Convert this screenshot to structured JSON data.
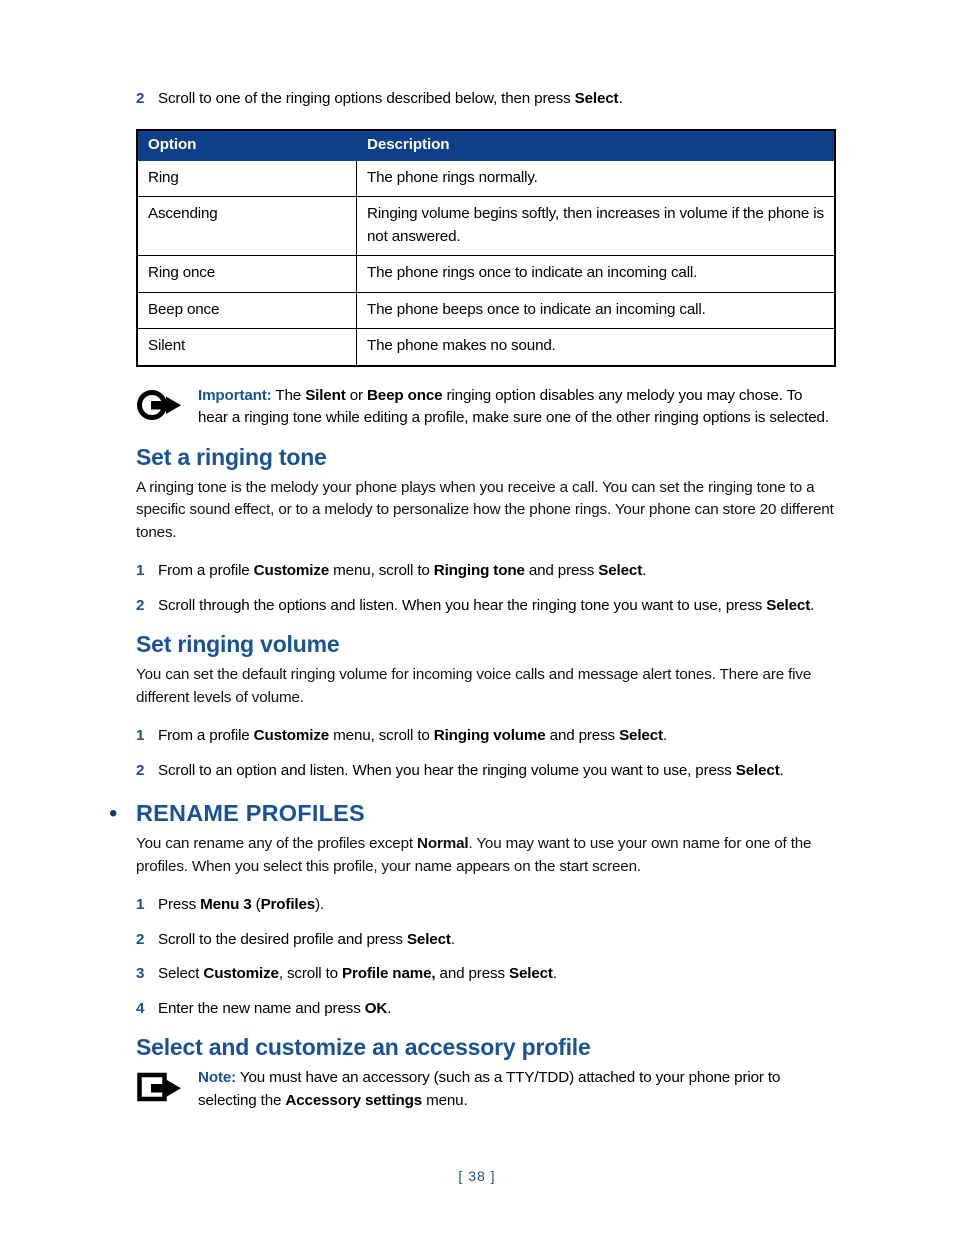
{
  "page": {
    "number_label": "[ 38 ]"
  },
  "intro_step": {
    "num": "2",
    "text_before": "Scroll to one of the ringing options described below, then press ",
    "bold": "Select",
    "text_after": "."
  },
  "table": {
    "headers": [
      "Option",
      "Description"
    ],
    "rows": [
      {
        "option": "Ring",
        "description": "The phone rings normally."
      },
      {
        "option": "Ascending",
        "description": "Ringing volume begins softly, then increases in volume if the phone is not answered."
      },
      {
        "option": "Ring once",
        "description": "The phone rings once to indicate an incoming call."
      },
      {
        "option": "Beep once",
        "description": "The phone beeps once to indicate an incoming call."
      },
      {
        "option": "Silent",
        "description": "The phone makes no sound."
      }
    ]
  },
  "important_note": {
    "icon": "circle-arrow-right-icon",
    "label": "Important:",
    "p1": " The ",
    "b1": "Silent",
    "p2": " or ",
    "b2": "Beep once",
    "p3": " ringing option disables any melody you may chose. To hear a ringing tone while editing a profile, make sure one of the other ringing options is selected."
  },
  "set_ringing_tone": {
    "heading": "Set a ringing tone",
    "paragraph": "A ringing tone is the melody your phone plays when you receive a call. You can set the ringing tone to a specific sound effect, or to a melody to personalize how the phone rings. Your phone can store 20 different tones.",
    "steps": [
      {
        "num": "1",
        "t1": "From a profile ",
        "b1": "Customize",
        "t2": " menu, scroll to ",
        "b2": "Ringing tone",
        "t3": " and press ",
        "b3": "Select",
        "t4": "."
      },
      {
        "num": "2",
        "t1": "Scroll through the options and listen. When you hear the ringing tone you want to use, press ",
        "b1": "Select",
        "t2": "."
      }
    ]
  },
  "set_ringing_volume": {
    "heading": "Set ringing volume",
    "paragraph": "You can set the default ringing volume for incoming voice calls and message alert tones. There are five different levels of volume.",
    "steps": [
      {
        "num": "1",
        "t1": "From a profile ",
        "b1": "Customize",
        "t2": " menu, scroll to ",
        "b2": "Ringing volume",
        "t3": " and press ",
        "b3": "Select",
        "t4": "."
      },
      {
        "num": "2",
        "t1": "Scroll to an option and listen. When you hear the ringing volume you want to use, press ",
        "b1": "Select",
        "t2": "."
      }
    ]
  },
  "rename_profiles": {
    "bullet": "•",
    "heading": "RENAME PROFILES",
    "p1": "You can rename any of the profiles except ",
    "b1": "Normal",
    "p2": ". You may want to use your own name for one of the profiles. When you select this profile, your name appears on the start screen.",
    "steps": [
      {
        "num": "1",
        "t1": "Press ",
        "b1": "Menu 3",
        "t2": " (",
        "b2": "Profiles",
        "t3": ")."
      },
      {
        "num": "2",
        "t1": "Scroll to the desired profile and press ",
        "b1": "Select",
        "t2": "."
      },
      {
        "num": "3",
        "t1": "Select ",
        "b1": "Customize",
        "t2": ", scroll to ",
        "b2": "Profile name,",
        "t3": " and press ",
        "b3": "Select",
        "t4": "."
      },
      {
        "num": "4",
        "t1": "Enter the new name and press ",
        "b1": "OK",
        "t2": "."
      }
    ]
  },
  "accessory_profile": {
    "heading": "Select and customize an accessory profile",
    "note": {
      "icon": "square-arrow-right-icon",
      "label": "Note:",
      "p1": " You must have an accessory (such as a TTY/TDD) attached to your phone prior to selecting the ",
      "b1": "Accessory settings",
      "p2": " menu."
    }
  },
  "colors": {
    "heading_blue": "#1a5296",
    "table_header_blue": "#0d4089",
    "bullet_navy": "#14386e",
    "body_black": "#111111"
  }
}
